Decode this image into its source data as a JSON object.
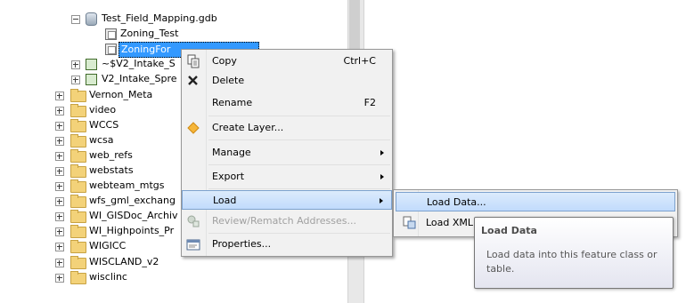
{
  "tree": {
    "gdb": "Test_Field_Mapping.gdb",
    "fc1": "Zoning_Test",
    "fc2": "ZoningFor",
    "rel1": "~$V2_Intake_S",
    "rel2": "V2_Intake_Spre",
    "folders": [
      "Vernon_Meta",
      "video",
      "WCCS",
      "wcsa",
      "web_refs",
      "webstats",
      "webteam_mtgs",
      "wfs_gml_exchang",
      "WI_GISDoc_Archiv",
      "WI_Highpoints_Pr",
      "WIGICC",
      "WISCLAND_v2",
      "wisclinc"
    ]
  },
  "menu": {
    "copy": "Copy",
    "copy_shortcut": "Ctrl+C",
    "delete": "Delete",
    "rename": "Rename",
    "rename_shortcut": "F2",
    "create_layer": "Create Layer...",
    "manage": "Manage",
    "export": "Export",
    "load": "Load",
    "review": "Review/Rematch Addresses...",
    "properties": "Properties..."
  },
  "submenu": {
    "load_data": "Load Data...",
    "load_xml": "Load XML"
  },
  "tooltip": {
    "title": "Load Data",
    "body": "Load data into this feature class or table."
  },
  "colors": {
    "selection": "#3399ff",
    "highlight": "#c1dbfc",
    "folder": "#f3d279"
  }
}
